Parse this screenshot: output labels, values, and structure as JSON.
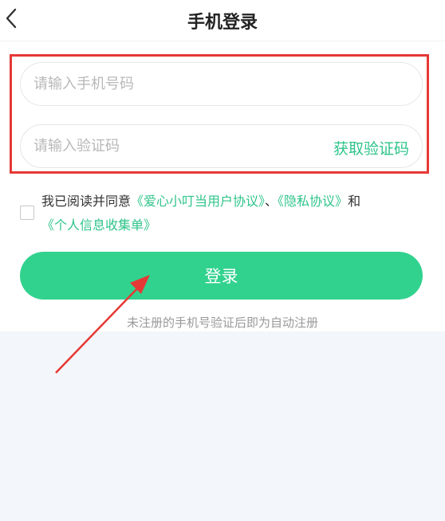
{
  "nav": {
    "title": "手机登录",
    "back_icon": "chevron-left-icon"
  },
  "form": {
    "phone_placeholder": "请输入手机号码",
    "code_placeholder": "请输入验证码",
    "get_code_label": "获取验证码"
  },
  "agreement": {
    "checked": false,
    "prefix": "我已阅读并同意",
    "link_user": "《爱心小叮当用户协议》",
    "sep": "、",
    "link_privacy": "《隐私协议》",
    "and": "和",
    "link_personal": "《个人信息收集单》"
  },
  "login": {
    "button_label": "登录",
    "hint": "未注册的手机号验证后即为自动注册"
  },
  "colors": {
    "accent": "#31d28e",
    "link": "#2fc48a",
    "annotation": "#e53935",
    "background": "#f3f6fa"
  }
}
